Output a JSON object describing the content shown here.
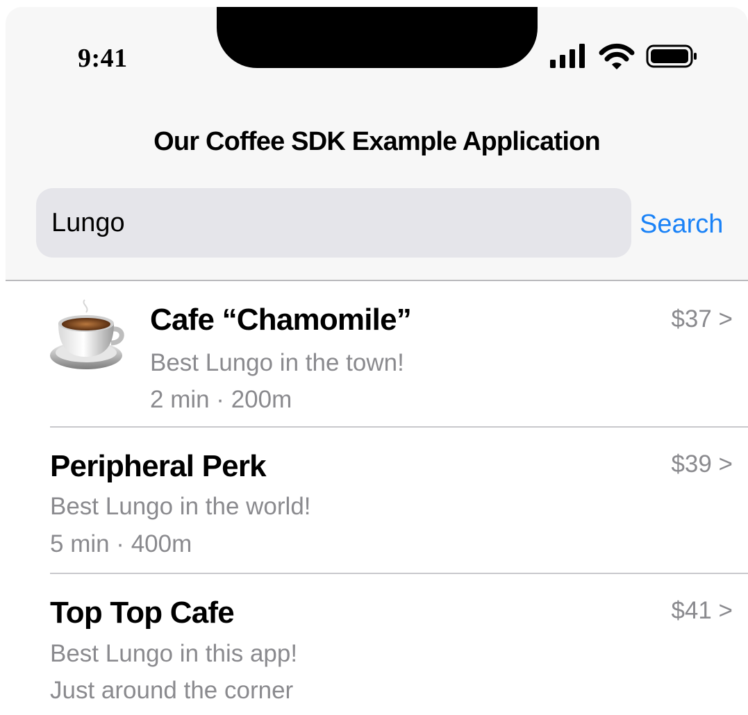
{
  "status_bar": {
    "time": "9:41",
    "icons": [
      "signal-icon",
      "wifi-icon",
      "battery-icon"
    ]
  },
  "nav": {
    "title": "Our Coffee SDK Example Application"
  },
  "search": {
    "value": "Lungo",
    "button_label": "Search"
  },
  "results": [
    {
      "title": "Cafe “Chamomile”",
      "description": "Best Lungo in the town!",
      "distance": "2 min · 200m",
      "price": "$37 >",
      "icon": "coffee-cup-icon"
    },
    {
      "title": "Peripheral Perk",
      "description": "Best Lungo in the world!",
      "distance": "5 min · 400m",
      "price": "$39 >"
    },
    {
      "title": "Top Top Cafe",
      "description": "Best Lungo in this app!",
      "distance": "Just around the corner",
      "price": "$41 >"
    }
  ],
  "colors": {
    "accent": "#1a82f7",
    "secondary_text": "#8a8a8e",
    "search_bg": "#e5e5ea",
    "header_bg": "#f7f7f7"
  }
}
